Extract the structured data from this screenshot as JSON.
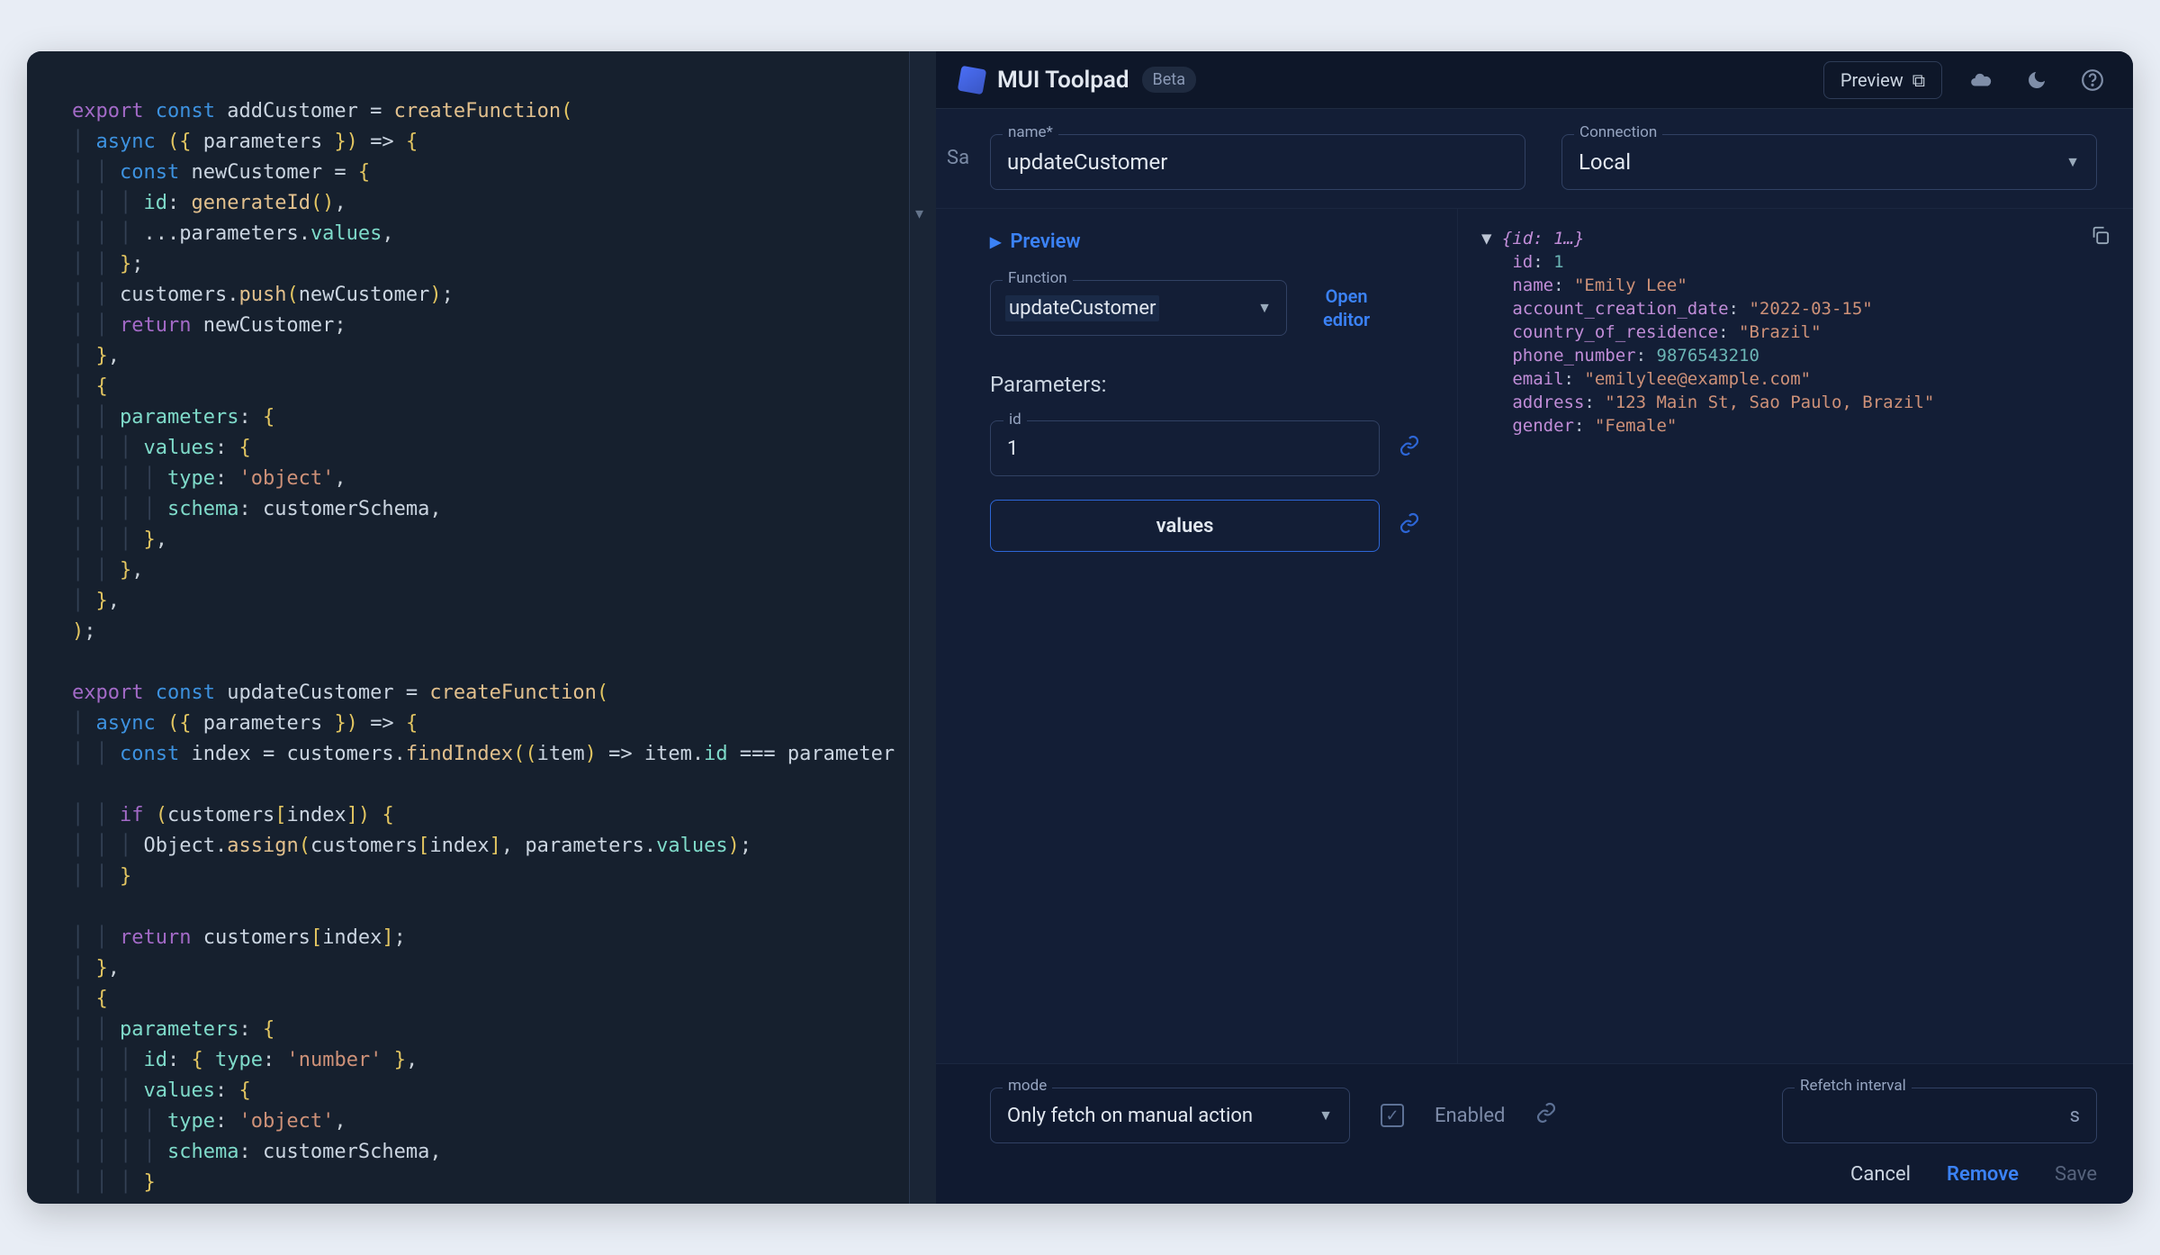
{
  "app": {
    "title": "MUI Toolpad",
    "badge": "Beta",
    "preview_btn": "Preview"
  },
  "config": {
    "name_label": "name*",
    "name_value": "updateCustomer",
    "conn_label": "Connection",
    "conn_value": "Local"
  },
  "panel": {
    "preview_link": "Preview",
    "function_label": "Function",
    "function_value": "updateCustomer",
    "open_editor_l1": "Open",
    "open_editor_l2": "editor",
    "params_heading": "Parameters:",
    "param_id_label": "id",
    "param_id_value": "1",
    "values_button": "values"
  },
  "result": {
    "header": "{id: 1…}",
    "lines": [
      [
        "id",
        "1",
        "num"
      ],
      [
        "name",
        "\"Emily Lee\"",
        "str"
      ],
      [
        "account_creation_date",
        "\"2022-03-15\"",
        "str"
      ],
      [
        "country_of_residence",
        "\"Brazil\"",
        "str"
      ],
      [
        "phone_number",
        "9876543210",
        "num"
      ],
      [
        "email",
        "\"emilylee@example.com\"",
        "str"
      ],
      [
        "address",
        "\"123 Main St, Sao Paulo, Brazil\"",
        "str"
      ],
      [
        "gender",
        "\"Female\"",
        "str"
      ]
    ]
  },
  "footer": {
    "mode_label": "mode",
    "mode_value": "Only fetch on manual action",
    "enabled_label": "Enabled",
    "refetch_label": "Refetch interval",
    "refetch_unit": "s",
    "cancel": "Cancel",
    "remove": "Remove",
    "save": "Save"
  },
  "hint_partial": "Sa",
  "colors": {
    "accent": "#3b82f6"
  }
}
